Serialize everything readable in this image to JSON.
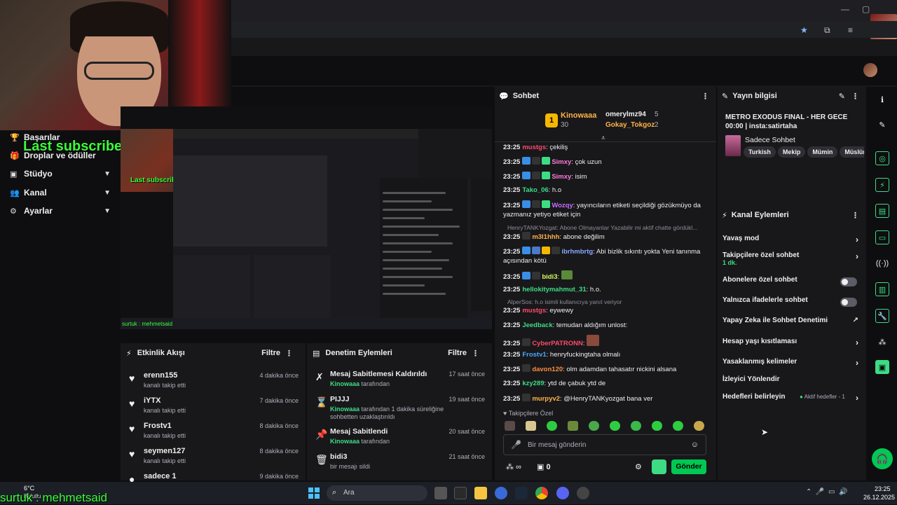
{
  "browser": {
    "bookmark_icon": "star-icon"
  },
  "sidebar": {
    "items": [
      {
        "label": "Başarılar",
        "icon": "trophy-icon"
      },
      {
        "label": "Droplar ve ödüller",
        "icon": "gift-icon"
      },
      {
        "label": "Stüdyo",
        "icon": "camera-icon"
      },
      {
        "label": "Kanal",
        "icon": "people-icon"
      },
      {
        "label": "Ayarlar",
        "icon": "gear-icon"
      }
    ]
  },
  "overlay": {
    "last_subscriber": "Last subscriber: Mardelva",
    "bottom_name": "surtuk : mehmetsaid"
  },
  "preview": {
    "last_subscriber": "Last subscriber: Mardelva",
    "name": "surtuk : mehmetsaid"
  },
  "activity": {
    "title": "Etkinlik Akışı",
    "filter": "Filtre",
    "events": [
      {
        "name": "erenn155",
        "sub": "kanalı takip etti",
        "time": "4 dakika önce"
      },
      {
        "name": "iYTX",
        "sub": "kanalı takip etti",
        "time": "7 dakika önce"
      },
      {
        "name": "Frostv1",
        "sub": "kanalı takip etti",
        "time": "8 dakika önce"
      },
      {
        "name": "seymen127",
        "sub": "kanalı takip etti",
        "time": "8 dakika önce"
      },
      {
        "name": "sadece 1",
        "sub": "",
        "time": "9 dakika önce"
      }
    ]
  },
  "modlog": {
    "title": "Denetim Eylemleri",
    "filter": "Filtre",
    "items": [
      {
        "name": "Mesaj Sabitlemesi Kaldırıldı",
        "by": "Kinowaaa",
        "rest": " tarafından",
        "time": "17 saat önce"
      },
      {
        "name": "PIJJJ",
        "by": "Kinowaaa",
        "rest": " tarafından 1 dakika süreliğine sohbetten uzaklaştırıldı",
        "time": "19 saat önce"
      },
      {
        "name": "Mesaj Sabitlendi",
        "by": "Kinowaaa",
        "rest": " tarafından",
        "time": "20 saat önce"
      },
      {
        "name": "bidi3",
        "by": "",
        "rest": "bir mesajı sildi",
        "time": "21 saat önce"
      }
    ]
  },
  "chat": {
    "title": "Sohbet",
    "leaderboard": {
      "first": "Kinowaaa",
      "first_count": "30",
      "second": "omerylmz94",
      "second_count": "5",
      "third": "Gokay_Tokgoz",
      "third_count": "2",
      "rank": "1"
    },
    "messages": [
      {
        "time": "23:25",
        "user": "mustgs",
        "color": "#ff4a6a",
        "text": ": çekiliş"
      },
      {
        "time": "23:25",
        "user": "Simxy",
        "color": "#ff7ad9",
        "text": ": çok uzun"
      },
      {
        "time": "23:25",
        "user": "Simxy",
        "color": "#ff7ad9",
        "text": ": isim"
      },
      {
        "time": "23:25",
        "user": "Tako_06",
        "color": "#3ddc84",
        "text": ": h.o"
      },
      {
        "time": "23:25",
        "user": "Wozqy",
        "color": "#c86bff",
        "text": ": yayıncıların etiketi seçildiği gözükmüyo da yazmanız yetiyo etiket için"
      },
      {
        "time": "23:25",
        "user": "m3l1hhh",
        "color": "#ffb347",
        "text": ": abone değilim"
      },
      {
        "time": "23:25",
        "user": "ibrhmbrtg",
        "color": "#8aa8ff",
        "text": ": Abi bizlik sıkıntı yokta Yeni tanınma açısından kötü"
      },
      {
        "time": "23:25",
        "user": "bidi3",
        "color": "#d8ff5a",
        "text": ":"
      },
      {
        "time": "23:25",
        "user": "hellokitymahmut_31",
        "color": "#3ddc84",
        "text": ": h.o."
      },
      {
        "time": "23:25",
        "user": "mustgs",
        "color": "#ff4a6a",
        "text": ": eywewy"
      },
      {
        "time": "23:25",
        "user": "Jeedback",
        "color": "#3ddc84",
        "text": ": temudan aldığım unlost:"
      },
      {
        "time": "23:25",
        "user": "CyberPATRONN",
        "color": "#ff4a6a",
        "text": ":"
      },
      {
        "time": "23:25",
        "user": "Frostv1",
        "color": "#4aa8ff",
        "text": ": henryfuckingtaha olmalı"
      },
      {
        "time": "23:25",
        "user": "davon120",
        "color": "#ff8c3a",
        "text": ": olm adamdan tahasatır nickini alsana"
      },
      {
        "time": "23:25",
        "user": "kzy289",
        "color": "#3ddc84",
        "text": ": ytd de çabuk ytd de"
      },
      {
        "time": "23:25",
        "user": "murpyv2",
        "color": "#ffb347",
        "text": ": @HenryTANKyozgat bana ver"
      }
    ],
    "replies": [
      "HenryTANKYozgat: Abone Olmayanlar Yazabilir mi aktif chatte gördükl...",
      "AlperSos: h.o isimli kullanıcıya yanıt veriyor"
    ],
    "followers_only": "Takipçilere Özel",
    "input_placeholder": "Bir mesaj gönderin",
    "points": "0",
    "send": "Gönder"
  },
  "info": {
    "title": "Yayın bilgisi",
    "stream_title": "METRO EXODUS FINAL - HER GECE 00:00 | insta:satirtaha",
    "category": "Sadece Sohbet",
    "tags": [
      "Turkish",
      "Mekip",
      "Mümin",
      "Müslüm"
    ]
  },
  "actions": {
    "title": "Kanal Eylemleri",
    "items": [
      {
        "label": "Yavaş mod",
        "sub": ""
      },
      {
        "label": "Takipçilere özel sohbet",
        "sub": "1 dk."
      },
      {
        "label": "Abonelere özel sohbet",
        "sub": ""
      },
      {
        "label": "Yalnızca ifadelerle sohbet",
        "sub": ""
      },
      {
        "label": "Yapay Zeka ile Sohbet Denetimi",
        "sub": ""
      },
      {
        "label": "Hesap yaşı kısıtlaması",
        "sub": ""
      },
      {
        "label": "Yasaklanmış kelimeler",
        "sub": ""
      },
      {
        "label": "İzleyici Yönlendir",
        "sub": ""
      },
      {
        "label": "Hedefleri belirleyin",
        "sub": ""
      }
    ],
    "goal_status": "Aktif hedefler - 1"
  },
  "taskbar": {
    "weather": "6°C",
    "weather_sub": "Bulutlu",
    "search": "Ara",
    "time": "23:25",
    "date": "26.12.2025"
  },
  "colors": {
    "accent": "#00e701",
    "green_name": "#3ddc84",
    "bg": "#18181b"
  }
}
